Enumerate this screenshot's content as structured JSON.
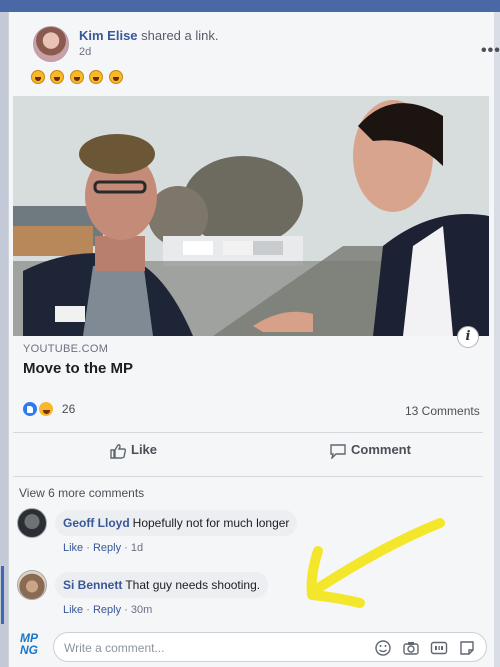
{
  "post": {
    "author": "Kim Elise",
    "action_text": "shared a link.",
    "timestamp": "2d",
    "more_glyph": "•••",
    "emoji_count_visible": 5,
    "emoji_icon": "grinning-squint-emoji"
  },
  "link": {
    "domain": "YOUTUBE.COM",
    "title": "Move to the MP",
    "info_glyph": "i"
  },
  "reactions": {
    "icons": [
      "like-reaction-icon",
      "haha-reaction-icon"
    ],
    "count": "26",
    "comments": "13 Comments"
  },
  "actions": {
    "like": "Like",
    "comment": "Comment"
  },
  "comments_section": {
    "view_more": "View 6 more comments",
    "items": [
      {
        "name": "Geoff Lloyd",
        "text": "Hopefully not for much longer",
        "like": "Like",
        "reply": "Reply",
        "time": "1d"
      },
      {
        "name": "Si Bennett",
        "text": "That guy needs shooting.",
        "like": "Like",
        "reply": "Reply",
        "time": "30m"
      }
    ]
  },
  "composer": {
    "logo_text_top": "MP",
    "logo_text_bottom": "NG",
    "placeholder": "Write a comment...",
    "icons": [
      "emoji-icon",
      "camera-icon",
      "gif-icon",
      "sticker-icon"
    ]
  },
  "colors": {
    "link_blue": "#385898",
    "reaction_like": "#2d7bf4",
    "reaction_haha": "#f7b928",
    "annotation_arrow": "#f4e62a"
  }
}
